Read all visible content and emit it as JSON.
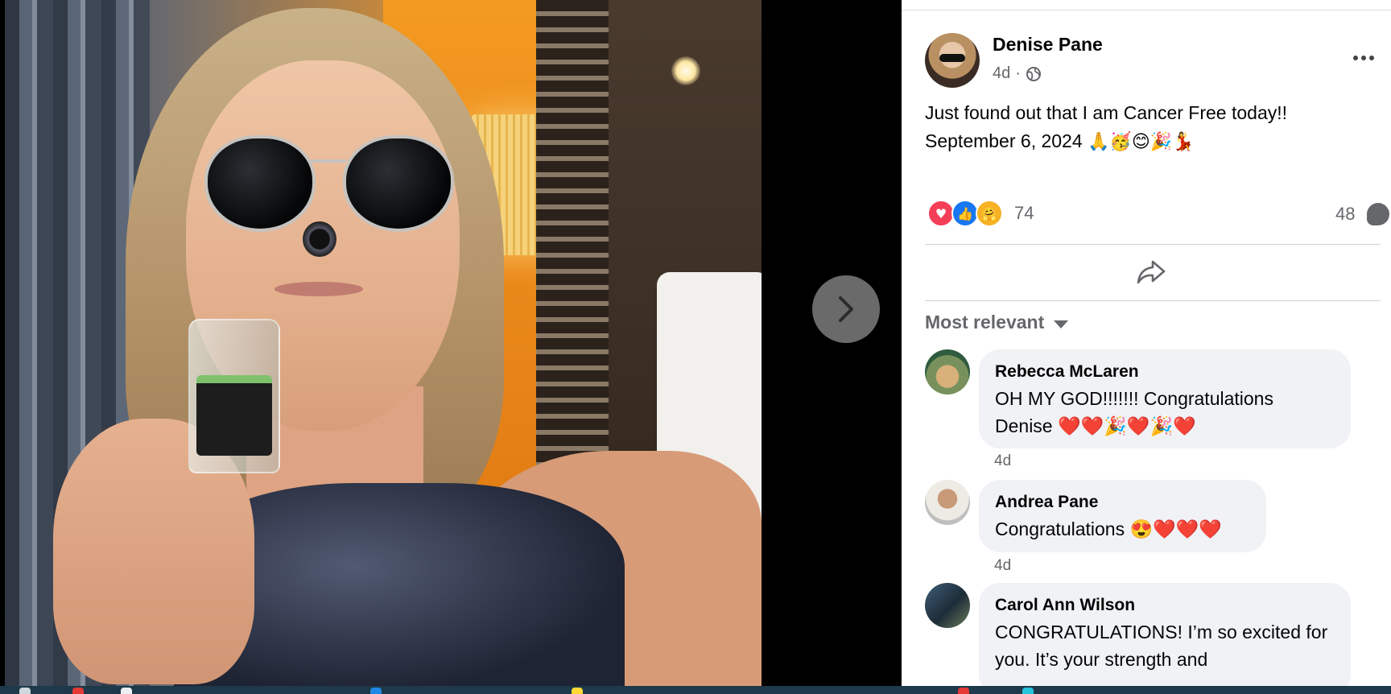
{
  "post": {
    "author": "Denise Pane",
    "time": "4d",
    "separator": "·",
    "text_line1": "Just found out that I am Cancer Free today!!",
    "text_line2": "September 6, 2024",
    "text_emojis": "🙏🥳😊🎉💃",
    "reaction_count": "74",
    "comment_count": "48"
  },
  "reactions": [
    "love",
    "like",
    "care"
  ],
  "sort_label": "Most relevant",
  "comments": [
    {
      "name": "Rebecca McLaren",
      "text": "OH MY GOD!!!!!!! Congratulations Denise ❤️❤️🎉❤️🎉❤️",
      "time": "4d"
    },
    {
      "name": "Andrea Pane",
      "text": "Congratulations 😍❤️❤️❤️",
      "time": "4d"
    },
    {
      "name": "Carol Ann Wilson",
      "text": "CONGRATULATIONS! I’m so excited for you. It’s your strength and",
      "time": ""
    }
  ],
  "icons": {
    "next": "chevron-right-icon",
    "privacy": "globe-icon",
    "more": "more-horizontal-icon",
    "share": "share-icon",
    "sort": "caret-down-icon",
    "comment": "comment-bubble-icon"
  },
  "colors": {
    "link_blue": "#1877f2",
    "love_red": "#f33e58",
    "secondary_text": "#65676b",
    "bubble_bg": "#f0f2f5"
  }
}
